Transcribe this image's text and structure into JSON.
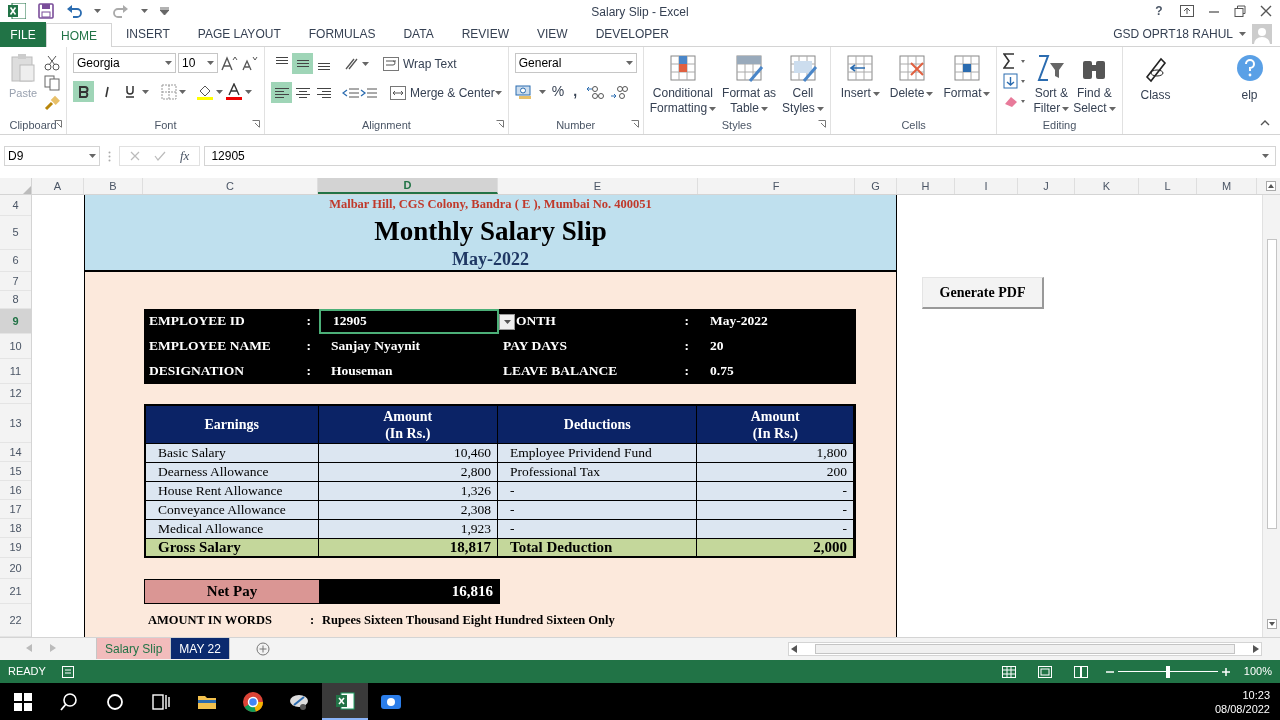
{
  "title_bar": {
    "title": "Salary Slip - Excel",
    "help": "?"
  },
  "user": {
    "name": "GSD  OPRT18 RAHUL"
  },
  "file_button": "FILE",
  "ribbon_tabs": [
    {
      "label": "HOME",
      "selected": true
    },
    {
      "label": "INSERT",
      "selected": false
    },
    {
      "label": "PAGE LAYOUT",
      "selected": false
    },
    {
      "label": "FORMULAS",
      "selected": false
    },
    {
      "label": "DATA",
      "selected": false
    },
    {
      "label": "REVIEW",
      "selected": false
    },
    {
      "label": "VIEW",
      "selected": false
    },
    {
      "label": "DEVELOPER",
      "selected": false
    }
  ],
  "ribbon": {
    "clipboard": {
      "paste": "Paste",
      "label": "Clipboard"
    },
    "font": {
      "name": "Georgia",
      "size": "10",
      "bold": true,
      "italic": false,
      "underline": false,
      "label": "Font"
    },
    "alignment": {
      "vertical_buttons": [
        {
          "selected": false
        },
        {
          "selected": true
        },
        {
          "selected": false
        }
      ],
      "horizontal_buttons": [
        {
          "selected": true
        },
        {
          "selected": false
        },
        {
          "selected": false
        }
      ],
      "wrap_text": "Wrap Text",
      "merge": "Merge & Center",
      "label": "Alignment"
    },
    "number": {
      "format": "General",
      "percent": "%",
      "comma": ",",
      "label": "Number"
    },
    "styles": {
      "buttons": [
        {
          "lines": [
            "Conditional",
            "Formatting"
          ]
        },
        {
          "lines": [
            "Format as",
            "Table"
          ]
        },
        {
          "lines": [
            "Cell",
            "Styles"
          ]
        }
      ],
      "label": "Styles"
    },
    "cells": {
      "buttons": [
        {
          "lines": [
            "Insert"
          ]
        },
        {
          "lines": [
            "Delete"
          ]
        },
        {
          "lines": [
            "Format"
          ]
        }
      ],
      "label": "Cells"
    },
    "editing": {
      "buttons": [
        {
          "lines": [
            "Sort &",
            "Filter"
          ]
        },
        {
          "lines": [
            "Find &",
            "Select"
          ]
        }
      ],
      "label": "Editing"
    },
    "extra": {
      "buttons": [
        {
          "lines": [
            "Class"
          ]
        },
        {
          "lines": [
            "elp"
          ]
        }
      ]
    }
  },
  "formula_bar": {
    "name_box": "D9",
    "function_label": "fx",
    "value": "12905"
  },
  "columns": [
    {
      "label": "A",
      "selected": false
    },
    {
      "label": "B",
      "selected": false
    },
    {
      "label": "C",
      "selected": false
    },
    {
      "label": "D",
      "selected": true
    },
    {
      "label": "E",
      "selected": false
    },
    {
      "label": "F",
      "selected": false
    },
    {
      "label": "G",
      "selected": false
    },
    {
      "label": "H",
      "selected": false
    },
    {
      "label": "I",
      "selected": false
    },
    {
      "label": "J",
      "selected": false
    },
    {
      "label": "K",
      "selected": false
    },
    {
      "label": "L",
      "selected": false
    },
    {
      "label": "M",
      "selected": false
    }
  ],
  "rows": [
    {
      "label": "4",
      "selected": false
    },
    {
      "label": "5",
      "selected": false
    },
    {
      "label": "6",
      "selected": false
    },
    {
      "label": "7",
      "selected": false
    },
    {
      "label": "8",
      "selected": false
    },
    {
      "label": "9",
      "selected": true
    },
    {
      "label": "10",
      "selected": false
    },
    {
      "label": "11",
      "selected": false
    },
    {
      "label": "12",
      "selected": false
    },
    {
      "label": "13",
      "selected": false
    },
    {
      "label": "14",
      "selected": false
    },
    {
      "label": "15",
      "selected": false
    },
    {
      "label": "16",
      "selected": false
    },
    {
      "label": "17",
      "selected": false
    },
    {
      "label": "18",
      "selected": false
    },
    {
      "label": "19",
      "selected": false
    },
    {
      "label": "20",
      "selected": false
    },
    {
      "label": "21",
      "selected": false
    },
    {
      "label": "22",
      "selected": false
    }
  ],
  "slip": {
    "address": "Malbar Hill, CGS Colony, Bandra ( E ), Mumbai No. 400051",
    "title": "Monthly Salary Slip",
    "period": "May-2022",
    "info_rows": [
      {
        "left": {
          "label": "EMPLOYEE ID",
          "separator": ":",
          "value": "12905",
          "selected": true
        },
        "right": {
          "label": "ONTH",
          "separator": ":",
          "value": "May-2022"
        }
      },
      {
        "left": {
          "label": "EMPLOYEE NAME",
          "separator": ":",
          "value": "Sanjay Nyaynit",
          "selected": false
        },
        "right": {
          "label": "PAY DAYS",
          "separator": ":",
          "value": "20"
        }
      },
      {
        "left": {
          "label": "DESIGNATION",
          "separator": ":",
          "value": "Houseman",
          "selected": false
        },
        "right": {
          "label": "LEAVE BALANCE",
          "separator": ":",
          "value": "0.75"
        }
      }
    ],
    "table": {
      "columns": [
        {
          "lines": [
            "Earnings"
          ]
        },
        {
          "lines": [
            "Amount",
            "(In Rs.)"
          ]
        },
        {
          "lines": [
            "Deductions"
          ]
        },
        {
          "lines": [
            "Amount",
            "(In Rs.)"
          ]
        }
      ],
      "rows": [
        [
          "Basic Salary",
          "10,460",
          "Employee Prividend Fund",
          "1,800"
        ],
        [
          "Dearness Allowance",
          "2,800",
          "Professional Tax",
          "200"
        ],
        [
          "House Rent Allowance",
          "1,326",
          "-",
          "-"
        ],
        [
          "Conveyance Allowance",
          "2,308",
          "-",
          "-"
        ],
        [
          "Medical Allowance",
          "1,923",
          "-",
          "-"
        ]
      ],
      "total": [
        "Gross Salary",
        "18,817",
        "Total Deduction",
        "2,000"
      ]
    },
    "net_pay": {
      "label": "Net Pay",
      "value": "16,816"
    },
    "amount_in_words": {
      "label": "AMOUNT IN WORDS",
      "separator": ":",
      "value": "Rupees Sixteen Thousand Eight Hundred Sixteen Only"
    }
  },
  "generate_button": "Generate PDF",
  "sheet_tabs": [
    {
      "label": "Salary Slip",
      "selected": true,
      "color": "#f2bcbc"
    },
    {
      "label": "MAY 22",
      "selected": false,
      "color": "#0b2a6e"
    }
  ],
  "status_bar": {
    "text": "READY",
    "zoom": {
      "level": 0.5,
      "reading": "100%"
    }
  },
  "taskbar": {
    "time": "10:23",
    "date": "08/08/2022"
  }
}
